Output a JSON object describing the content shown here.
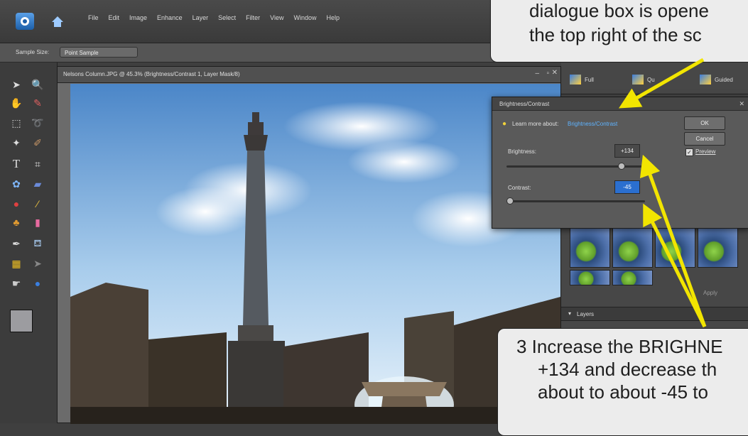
{
  "menu": {
    "items": [
      "File",
      "Edit",
      "Image",
      "Enhance",
      "Layer",
      "Select",
      "Filter",
      "View",
      "Window",
      "Help"
    ]
  },
  "options_bar": {
    "label": "Sample Size:",
    "value": "Point Sample"
  },
  "document": {
    "title": "Nelsons Column.JPG @ 45.3% (Brightness/Contrast 1, Layer Mask/8)"
  },
  "panel": {
    "buttons": [
      "Full",
      "Qu",
      "Guided"
    ],
    "apply_label": "Apply",
    "layers_label": "Layers"
  },
  "dialog": {
    "title": "Brightness/Contrast",
    "learn_text": "Learn more about:",
    "learn_link": "Brightness/Contrast",
    "ok": "OK",
    "cancel": "Cancel",
    "preview": "Preview",
    "brightness_label": "Brightness:",
    "brightness_value": "+134",
    "brightness_fraction": 0.85,
    "contrast_label": "Contrast:",
    "contrast_value": "-45",
    "contrast_fraction": 0.0
  },
  "callout_top": {
    "line1": "dialogue box is opene",
    "line2": "the top right of the sc"
  },
  "callout_bottom": {
    "line1": "3  Increase the BRIGHNE",
    "line2": "+134 and decrease th",
    "line3": "about to about -45 to"
  },
  "colors": {
    "accent_blue": "#2b7fd9",
    "arrow_yellow": "#f2e500",
    "dialog_bg": "#5a5a5a"
  },
  "icons": [
    "app-icon",
    "home-icon",
    "move-icon",
    "zoom-icon",
    "hand-icon",
    "eyedropper-icon",
    "marquee-icon",
    "lasso-icon",
    "magic-wand-icon",
    "brush-selection-icon",
    "type-icon",
    "crop-icon",
    "cookie-cutter-icon",
    "straighten-icon",
    "red-eye-icon",
    "spot-healing-icon",
    "clone-stamp-icon",
    "eraser-icon",
    "brush-icon",
    "paint-bucket-icon",
    "gradient-icon",
    "shape-icon",
    "blur-icon",
    "sponge-icon",
    "lightbulb-icon",
    "checkbox-icon"
  ]
}
